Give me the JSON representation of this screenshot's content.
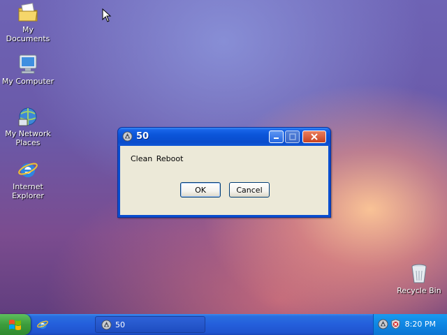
{
  "desktop": {
    "icons": [
      {
        "label": "My Documents",
        "icon": "my-documents-folder-icon"
      },
      {
        "label": "My Computer",
        "icon": "my-computer-icon"
      },
      {
        "label": "My Network Places",
        "icon": "network-places-icon"
      },
      {
        "label": "Internet Explorer",
        "icon": "internet-explorer-icon"
      },
      {
        "label": "Recycle Bin",
        "icon": "recycle-bin-icon"
      }
    ]
  },
  "dialog": {
    "title": "50",
    "message": "Clean Reboot",
    "ok_label": "OK",
    "cancel_label": "Cancel"
  },
  "taskbar": {
    "task_button_label": "50",
    "clock": "8:20 PM"
  },
  "colors": {
    "titlebar": "#0a4ecf",
    "taskbar": "#245edb",
    "start_button": "#3c9c3c",
    "dialog_face": "#ece9d8"
  }
}
